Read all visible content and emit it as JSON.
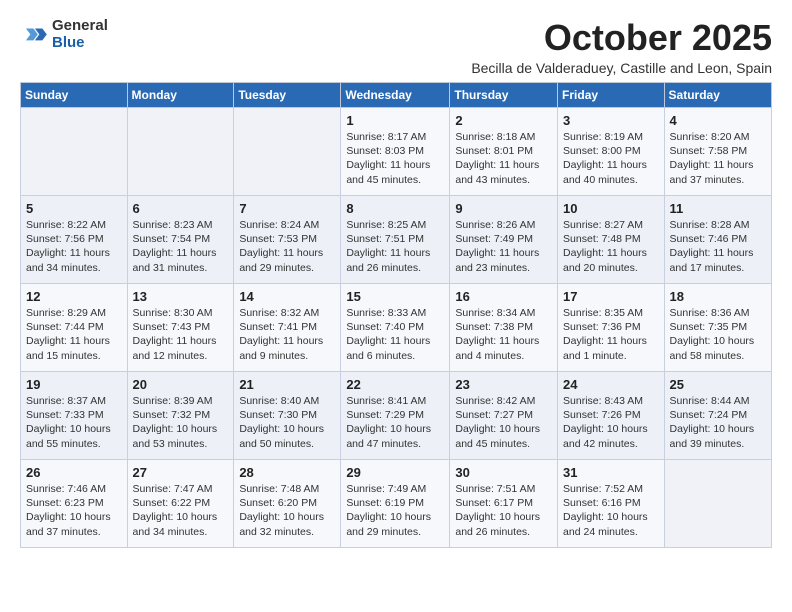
{
  "logo": {
    "general": "General",
    "blue": "Blue"
  },
  "title": "October 2025",
  "location": "Becilla de Valderaduey, Castille and Leon, Spain",
  "weekdays": [
    "Sunday",
    "Monday",
    "Tuesday",
    "Wednesday",
    "Thursday",
    "Friday",
    "Saturday"
  ],
  "weeks": [
    [
      {
        "day": "",
        "text": ""
      },
      {
        "day": "",
        "text": ""
      },
      {
        "day": "",
        "text": ""
      },
      {
        "day": "1",
        "text": "Sunrise: 8:17 AM\nSunset: 8:03 PM\nDaylight: 11 hours and 45 minutes."
      },
      {
        "day": "2",
        "text": "Sunrise: 8:18 AM\nSunset: 8:01 PM\nDaylight: 11 hours and 43 minutes."
      },
      {
        "day": "3",
        "text": "Sunrise: 8:19 AM\nSunset: 8:00 PM\nDaylight: 11 hours and 40 minutes."
      },
      {
        "day": "4",
        "text": "Sunrise: 8:20 AM\nSunset: 7:58 PM\nDaylight: 11 hours and 37 minutes."
      }
    ],
    [
      {
        "day": "5",
        "text": "Sunrise: 8:22 AM\nSunset: 7:56 PM\nDaylight: 11 hours and 34 minutes."
      },
      {
        "day": "6",
        "text": "Sunrise: 8:23 AM\nSunset: 7:54 PM\nDaylight: 11 hours and 31 minutes."
      },
      {
        "day": "7",
        "text": "Sunrise: 8:24 AM\nSunset: 7:53 PM\nDaylight: 11 hours and 29 minutes."
      },
      {
        "day": "8",
        "text": "Sunrise: 8:25 AM\nSunset: 7:51 PM\nDaylight: 11 hours and 26 minutes."
      },
      {
        "day": "9",
        "text": "Sunrise: 8:26 AM\nSunset: 7:49 PM\nDaylight: 11 hours and 23 minutes."
      },
      {
        "day": "10",
        "text": "Sunrise: 8:27 AM\nSunset: 7:48 PM\nDaylight: 11 hours and 20 minutes."
      },
      {
        "day": "11",
        "text": "Sunrise: 8:28 AM\nSunset: 7:46 PM\nDaylight: 11 hours and 17 minutes."
      }
    ],
    [
      {
        "day": "12",
        "text": "Sunrise: 8:29 AM\nSunset: 7:44 PM\nDaylight: 11 hours and 15 minutes."
      },
      {
        "day": "13",
        "text": "Sunrise: 8:30 AM\nSunset: 7:43 PM\nDaylight: 11 hours and 12 minutes."
      },
      {
        "day": "14",
        "text": "Sunrise: 8:32 AM\nSunset: 7:41 PM\nDaylight: 11 hours and 9 minutes."
      },
      {
        "day": "15",
        "text": "Sunrise: 8:33 AM\nSunset: 7:40 PM\nDaylight: 11 hours and 6 minutes."
      },
      {
        "day": "16",
        "text": "Sunrise: 8:34 AM\nSunset: 7:38 PM\nDaylight: 11 hours and 4 minutes."
      },
      {
        "day": "17",
        "text": "Sunrise: 8:35 AM\nSunset: 7:36 PM\nDaylight: 11 hours and 1 minute."
      },
      {
        "day": "18",
        "text": "Sunrise: 8:36 AM\nSunset: 7:35 PM\nDaylight: 10 hours and 58 minutes."
      }
    ],
    [
      {
        "day": "19",
        "text": "Sunrise: 8:37 AM\nSunset: 7:33 PM\nDaylight: 10 hours and 55 minutes."
      },
      {
        "day": "20",
        "text": "Sunrise: 8:39 AM\nSunset: 7:32 PM\nDaylight: 10 hours and 53 minutes."
      },
      {
        "day": "21",
        "text": "Sunrise: 8:40 AM\nSunset: 7:30 PM\nDaylight: 10 hours and 50 minutes."
      },
      {
        "day": "22",
        "text": "Sunrise: 8:41 AM\nSunset: 7:29 PM\nDaylight: 10 hours and 47 minutes."
      },
      {
        "day": "23",
        "text": "Sunrise: 8:42 AM\nSunset: 7:27 PM\nDaylight: 10 hours and 45 minutes."
      },
      {
        "day": "24",
        "text": "Sunrise: 8:43 AM\nSunset: 7:26 PM\nDaylight: 10 hours and 42 minutes."
      },
      {
        "day": "25",
        "text": "Sunrise: 8:44 AM\nSunset: 7:24 PM\nDaylight: 10 hours and 39 minutes."
      }
    ],
    [
      {
        "day": "26",
        "text": "Sunrise: 7:46 AM\nSunset: 6:23 PM\nDaylight: 10 hours and 37 minutes."
      },
      {
        "day": "27",
        "text": "Sunrise: 7:47 AM\nSunset: 6:22 PM\nDaylight: 10 hours and 34 minutes."
      },
      {
        "day": "28",
        "text": "Sunrise: 7:48 AM\nSunset: 6:20 PM\nDaylight: 10 hours and 32 minutes."
      },
      {
        "day": "29",
        "text": "Sunrise: 7:49 AM\nSunset: 6:19 PM\nDaylight: 10 hours and 29 minutes."
      },
      {
        "day": "30",
        "text": "Sunrise: 7:51 AM\nSunset: 6:17 PM\nDaylight: 10 hours and 26 minutes."
      },
      {
        "day": "31",
        "text": "Sunrise: 7:52 AM\nSunset: 6:16 PM\nDaylight: 10 hours and 24 minutes."
      },
      {
        "day": "",
        "text": ""
      }
    ]
  ]
}
